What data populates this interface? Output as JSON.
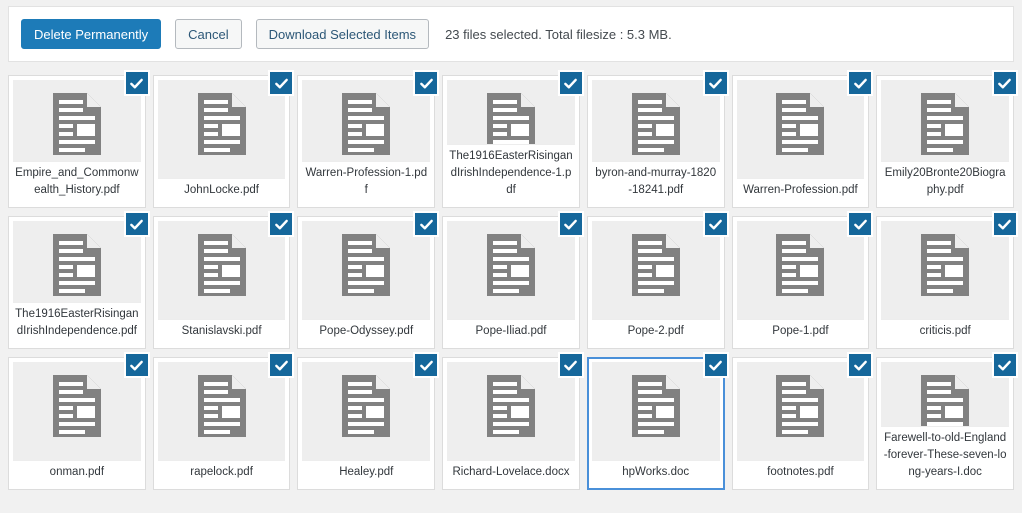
{
  "toolbar": {
    "delete_label": "Delete Permanently",
    "cancel_label": "Cancel",
    "download_label": "Download Selected Items",
    "status": "23 files selected. Total filesize : 5.3 MB.",
    "primary_color": "#1d7bb8",
    "checkbox_color": "#15679b",
    "focus_color": "#4a90d9"
  },
  "grid": {
    "columns": 7,
    "checked_icon": "check-icon",
    "file_icon": "document-icon",
    "files": [
      {
        "name": "Empire_and_Commonwealth_History.pdf",
        "checked": true,
        "focused": false
      },
      {
        "name": "JohnLocke.pdf",
        "checked": true,
        "focused": false
      },
      {
        "name": "Warren-Profession-1.pdf",
        "checked": true,
        "focused": false
      },
      {
        "name": "The1916EasterRisingandIrishIndependence-1.pdf",
        "checked": true,
        "focused": false
      },
      {
        "name": "byron-and-murray-1820-18241.pdf",
        "checked": true,
        "focused": false
      },
      {
        "name": "Warren-Profession.pdf",
        "checked": true,
        "focused": false
      },
      {
        "name": "Emily20Bronte20Biography.pdf",
        "checked": true,
        "focused": false
      },
      {
        "name": "The1916EasterRisingandIrishIndependence.pdf",
        "checked": true,
        "focused": false
      },
      {
        "name": "Stanislavski.pdf",
        "checked": true,
        "focused": false
      },
      {
        "name": "Pope-Odyssey.pdf",
        "checked": true,
        "focused": false
      },
      {
        "name": "Pope-Iliad.pdf",
        "checked": true,
        "focused": false
      },
      {
        "name": "Pope-2.pdf",
        "checked": true,
        "focused": false
      },
      {
        "name": "Pope-1.pdf",
        "checked": true,
        "focused": false
      },
      {
        "name": "criticis.pdf",
        "checked": true,
        "focused": false
      },
      {
        "name": "onman.pdf",
        "checked": true,
        "focused": false
      },
      {
        "name": "rapelock.pdf",
        "checked": true,
        "focused": false
      },
      {
        "name": "Healey.pdf",
        "checked": true,
        "focused": false
      },
      {
        "name": "Richard-Lovelace.docx",
        "checked": true,
        "focused": false
      },
      {
        "name": "hpWorks.doc",
        "checked": true,
        "focused": true
      },
      {
        "name": "footnotes.pdf",
        "checked": true,
        "focused": false
      },
      {
        "name": "Farewell-to-old-England-forever-These-seven-long-years-I.doc",
        "checked": true,
        "focused": false
      }
    ]
  }
}
